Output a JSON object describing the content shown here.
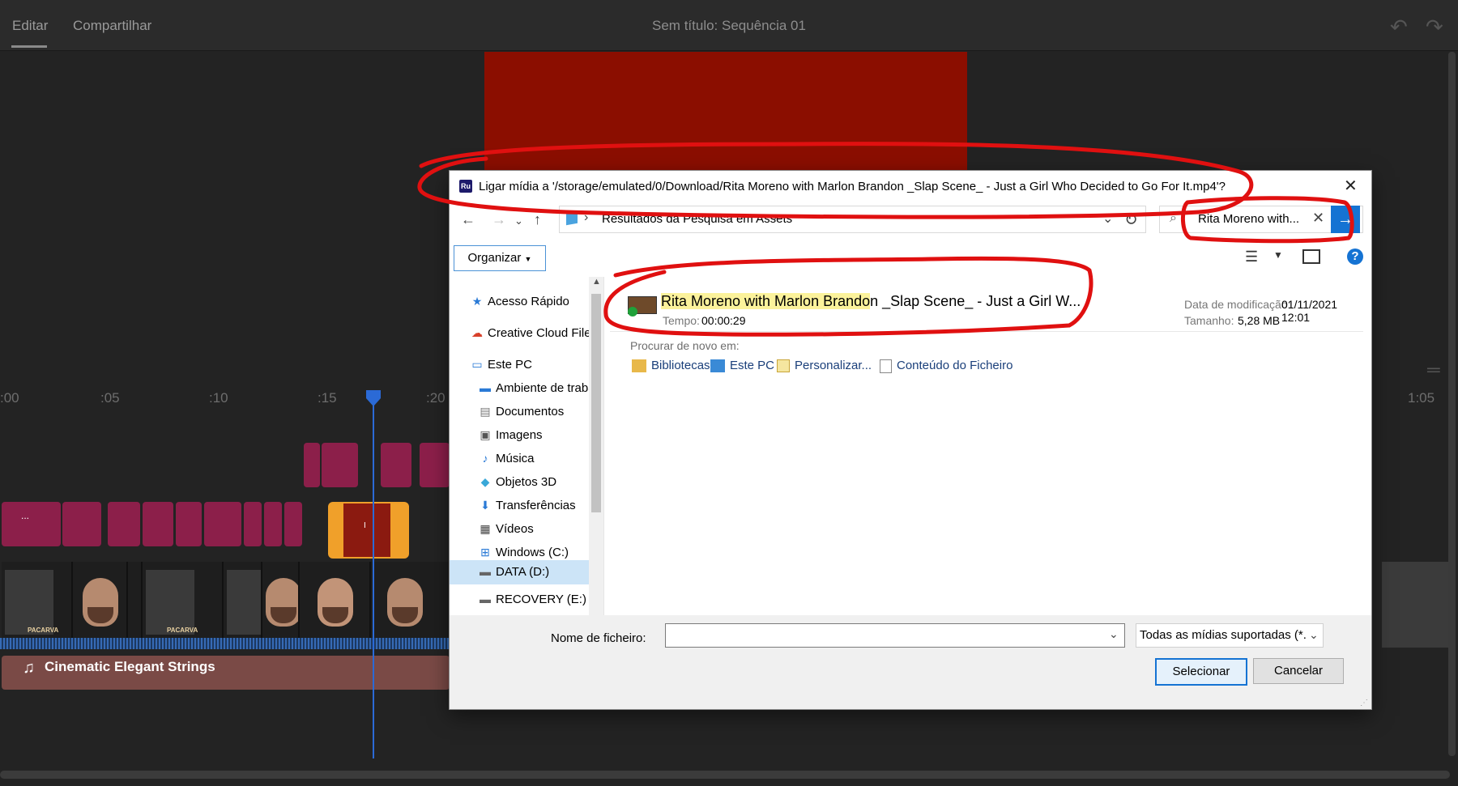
{
  "app": {
    "tabs": [
      "Editar",
      "Compartilhar"
    ],
    "sequence_title": "Sem título: Sequência 01",
    "undo_icon": "undo-icon",
    "redo_icon": "redo-icon"
  },
  "timeline": {
    "ticks": [
      ":00",
      ":05",
      ":10",
      ":15",
      ":20",
      "1:05"
    ],
    "title_clip_label": "...",
    "selected_clip_label": "I",
    "music_track_label": "Cinematic Elegant Strings",
    "thumbnail_badge": "PACARVA",
    "colors": {
      "clip": "#8c1f4a",
      "selected": "#f0a02a",
      "playhead": "#2b6ad6",
      "music": "#7a4a46"
    }
  },
  "dialog": {
    "title_icon": "Ru",
    "title": "Ligar mídia a '/storage/emulated/0/Download/Rita Moreno with Marlon Brandon _Slap Scene_ - Just a Girl Who Decided to Go For It.mp4'?",
    "address": "Resultados da Pesquisa em Assets",
    "search_value": "Rita Moreno with...",
    "organize_label": "Organizar",
    "nav_items": [
      {
        "label": "Acesso Rápido",
        "icon": "star-icon"
      },
      {
        "label": "Creative Cloud Files",
        "icon": "creative-cloud-icon"
      },
      {
        "label": "Este PC",
        "icon": "pc-icon"
      },
      {
        "label": "Ambiente de trabalho",
        "icon": "desktop-icon"
      },
      {
        "label": "Documentos",
        "icon": "documents-icon"
      },
      {
        "label": "Imagens",
        "icon": "images-icon"
      },
      {
        "label": "Música",
        "icon": "music-icon"
      },
      {
        "label": "Objetos 3D",
        "icon": "3d-objects-icon"
      },
      {
        "label": "Transferências",
        "icon": "downloads-icon"
      },
      {
        "label": "Vídeos",
        "icon": "videos-icon"
      },
      {
        "label": "Windows (C:)",
        "icon": "windows-drive-icon"
      },
      {
        "label": "DATA (D:)",
        "icon": "drive-icon"
      },
      {
        "label": "RECOVERY (E:)",
        "icon": "drive-icon"
      }
    ],
    "result": {
      "name_highlight": "Rita Moreno with Marlon Brando",
      "name_rest": "n _Slap Scene_ - Just a Girl W...",
      "tempo_label": "Tempo:",
      "tempo": "00:00:29",
      "modified_label": "Data de modificação:",
      "modified": "01/11/2021 12:01",
      "size_label": "Tamanho:",
      "size": "5,28 MB"
    },
    "search_again_label": "Procurar de novo em:",
    "search_again_items": [
      "Bibliotecas",
      "Este PC",
      "Personalizar...",
      "Conteúdo do Ficheiro"
    ],
    "filename_label": "Nome de ficheiro:",
    "filename_value": "",
    "filter_value": "Todas as mídias suportadas (*.HI",
    "select_label": "Selecionar",
    "cancel_label": "Cancelar"
  },
  "annotation_color": "#e01010"
}
